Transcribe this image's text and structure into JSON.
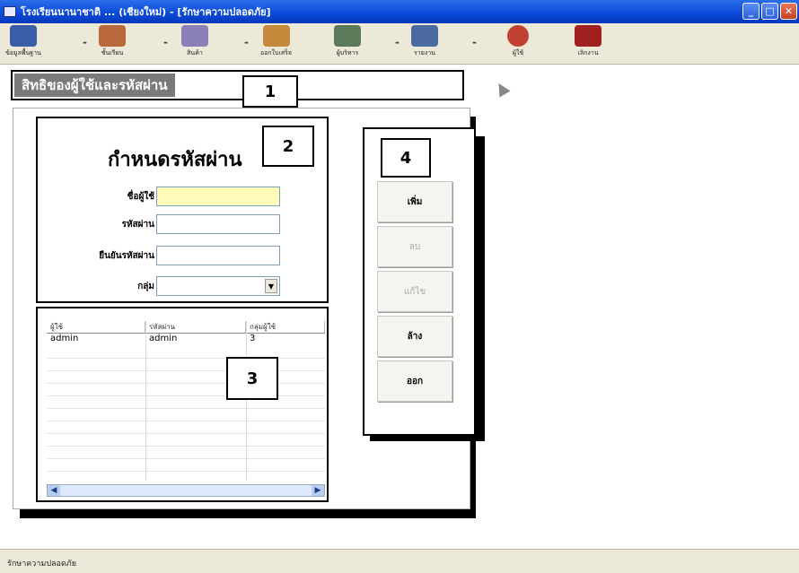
{
  "window": {
    "title": "โรงเรียนนานาชาติ ... (เชียงใหม่) - [รักษาความปลอดภัย]",
    "controls": {
      "minimize": "_",
      "maximize": "□",
      "close": "✕"
    }
  },
  "toolbar": {
    "items": [
      {
        "label": "ข้อมูลพื้นฐาน",
        "icon": "book-icon",
        "color": "#3a5da8"
      },
      {
        "label": "ชั้นเรียน",
        "icon": "school-icon",
        "color": "#b8683a"
      },
      {
        "label": "สินค้า",
        "icon": "goods-icon",
        "color": "#8a7fb6"
      },
      {
        "label": "ออกใบเสร็จ",
        "icon": "receipt-icon",
        "color": "#c28a3a"
      },
      {
        "label": "ผู้บริหาร",
        "icon": "admin-icon",
        "color": "#5a7a5a"
      },
      {
        "label": "รายงาน",
        "icon": "report-icon",
        "color": "#4b6aa0"
      },
      {
        "label": "ผู้ใช้",
        "icon": "user-icon",
        "color": "#c24030"
      },
      {
        "label": "เลิกงาน",
        "icon": "exit-icon",
        "color": "#a02020"
      }
    ],
    "separator": "-"
  },
  "header": {
    "title": "สิทธิของผู้ใช้และรหัสผ่าน"
  },
  "callouts": {
    "one": "1",
    "two": "2",
    "three": "3",
    "four": "4"
  },
  "form": {
    "title": "กำหนดรหัสผ่าน",
    "fields": {
      "username_label": "ชื่อผู้ใช้",
      "password_label": "รหัสผ่าน",
      "confirm_label": "ยืนยันรหัสผ่าน",
      "group_label": "กลุ่ม",
      "dropdown_arrow": "▼"
    }
  },
  "grid": {
    "columns": [
      "ผู้ใช้",
      "รหัสผ่าน",
      "กลุ่มผู้ใช้"
    ],
    "rows": [
      [
        "admin",
        "admin",
        "3"
      ]
    ],
    "scroll_left": "◀",
    "scroll_right": "▶"
  },
  "buttons": {
    "add": "เพิ่ม",
    "delete": "ลบ",
    "edit": "แก้ไข",
    "clear": "ล้าง",
    "exit": "ออก"
  },
  "statusbar": {
    "text": "รักษาความปลอดภัย"
  }
}
